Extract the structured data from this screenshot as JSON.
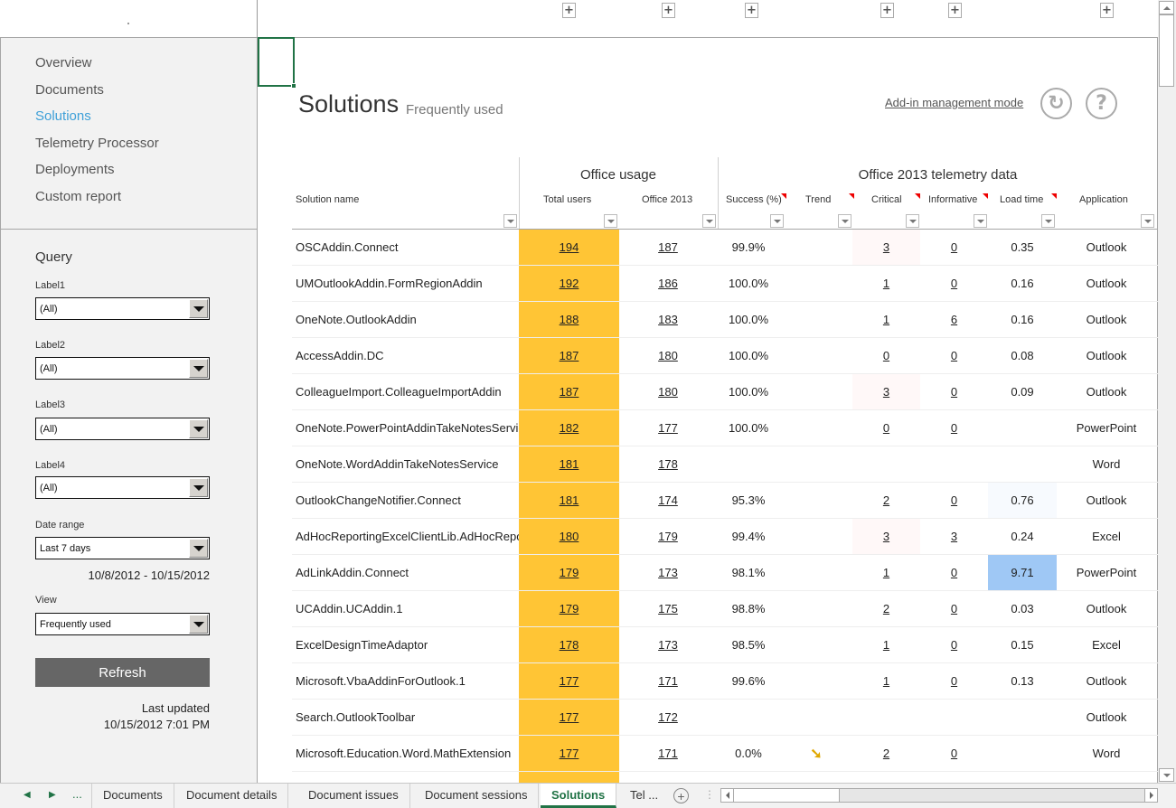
{
  "sidebar": {
    "nav": [
      {
        "label": "Overview",
        "active": false
      },
      {
        "label": "Documents",
        "active": false
      },
      {
        "label": "Solutions",
        "active": true
      },
      {
        "label": "Telemetry Processor",
        "active": false
      },
      {
        "label": "Deployments",
        "active": false
      },
      {
        "label": "Custom report",
        "active": false
      }
    ],
    "query": {
      "title": "Query",
      "label1": {
        "label": "Label1",
        "value": "(All)"
      },
      "label2": {
        "label": "Label2",
        "value": "(All)"
      },
      "label3": {
        "label": "Label3",
        "value": "(All)"
      },
      "label4": {
        "label": "Label4",
        "value": "(All)"
      },
      "date_range": {
        "label": "Date range",
        "value": "Last 7 days"
      },
      "date_span": "10/8/2012 - 10/15/2012",
      "view": {
        "label": "View",
        "value": "Frequently used"
      },
      "refresh_label": "Refresh",
      "last_updated_label": "Last updated",
      "last_updated_value": "10/15/2012 7:01 PM"
    }
  },
  "header": {
    "title": "Solutions",
    "subtitle": "Frequently used",
    "addin_mode_link": "Add-in management mode",
    "refresh_icon": "↻",
    "help_icon": "?"
  },
  "table": {
    "groups": {
      "office_usage": "Office usage",
      "telemetry": "Office 2013 telemetry data"
    },
    "columns": {
      "name": "Solution name",
      "total": "Total users",
      "o13": "Office 2013",
      "succ": "Success (%)",
      "trend": "Trend",
      "crit": "Critical",
      "info": "Informative",
      "load": "Load time",
      "app": "Application"
    },
    "rows": [
      {
        "name": "OSCAddin.Connect",
        "total": "194",
        "o13": "187",
        "succ": "99.9%",
        "trend": "",
        "crit": "3",
        "info": "0",
        "load": "0.35",
        "app": "Outlook"
      },
      {
        "name": "UMOutlookAddin.FormRegionAddin",
        "total": "192",
        "o13": "186",
        "succ": "100.0%",
        "trend": "",
        "crit": "1",
        "info": "0",
        "load": "0.16",
        "app": "Outlook"
      },
      {
        "name": "OneNote.OutlookAddin",
        "total": "188",
        "o13": "183",
        "succ": "100.0%",
        "trend": "",
        "crit": "1",
        "info": "6",
        "load": "0.16",
        "app": "Outlook"
      },
      {
        "name": "AccessAddin.DC",
        "total": "187",
        "o13": "180",
        "succ": "100.0%",
        "trend": "",
        "crit": "0",
        "info": "0",
        "load": "0.08",
        "app": "Outlook"
      },
      {
        "name": "ColleagueImport.ColleagueImportAddin",
        "total": "187",
        "o13": "180",
        "succ": "100.0%",
        "trend": "",
        "crit": "3",
        "info": "0",
        "load": "0.09",
        "app": "Outlook"
      },
      {
        "name": "OneNote.PowerPointAddinTakeNotesService",
        "total": "182",
        "o13": "177",
        "succ": "100.0%",
        "trend": "",
        "crit": "0",
        "info": "0",
        "load": "",
        "app": "PowerPoint"
      },
      {
        "name": "OneNote.WordAddinTakeNotesService",
        "total": "181",
        "o13": "178",
        "succ": "",
        "trend": "",
        "crit": "",
        "info": "",
        "load": "",
        "app": "Word"
      },
      {
        "name": "OutlookChangeNotifier.Connect",
        "total": "181",
        "o13": "174",
        "succ": "95.3%",
        "trend": "",
        "crit": "2",
        "info": "0",
        "load": "0.76",
        "app": "Outlook"
      },
      {
        "name": "AdHocReportingExcelClientLib.AdHocReportingExcelClient",
        "total": "180",
        "o13": "179",
        "succ": "99.4%",
        "trend": "",
        "crit": "3",
        "info": "3",
        "load": "0.24",
        "app": "Excel"
      },
      {
        "name": "AdLinkAddin.Connect",
        "total": "179",
        "o13": "173",
        "succ": "98.1%",
        "trend": "",
        "crit": "1",
        "info": "0",
        "load": "9.71",
        "app": "PowerPoint"
      },
      {
        "name": "UCAddin.UCAddin.1",
        "total": "179",
        "o13": "175",
        "succ": "98.8%",
        "trend": "",
        "crit": "2",
        "info": "0",
        "load": "0.03",
        "app": "Outlook"
      },
      {
        "name": "ExcelDesignTimeAdaptor",
        "total": "178",
        "o13": "173",
        "succ": "98.5%",
        "trend": "",
        "crit": "1",
        "info": "0",
        "load": "0.15",
        "app": "Excel"
      },
      {
        "name": "Microsoft.VbaAddinForOutlook.1",
        "total": "177",
        "o13": "171",
        "succ": "99.6%",
        "trend": "",
        "crit": "1",
        "info": "0",
        "load": "0.13",
        "app": "Outlook"
      },
      {
        "name": "Search.OutlookToolbar",
        "total": "177",
        "o13": "172",
        "succ": "",
        "trend": "",
        "crit": "",
        "info": "",
        "load": "",
        "app": "Outlook"
      },
      {
        "name": "Microsoft.Education.Word.MathExtension",
        "total": "177",
        "o13": "171",
        "succ": "0.0%",
        "trend": "down-arrow",
        "crit": "2",
        "info": "0",
        "load": "",
        "app": "Word"
      }
    ]
  },
  "tabs": {
    "items": [
      "Documents",
      "Document details",
      "Document issues",
      "Document sessions",
      "Solutions",
      "Tel ..."
    ],
    "active": "Solutions",
    "more": "..."
  },
  "colors": {
    "accent": "#217346",
    "highlight_users": "#ffc535",
    "load_high": "#9fc8f5",
    "nav_active": "#3ea0d8"
  }
}
